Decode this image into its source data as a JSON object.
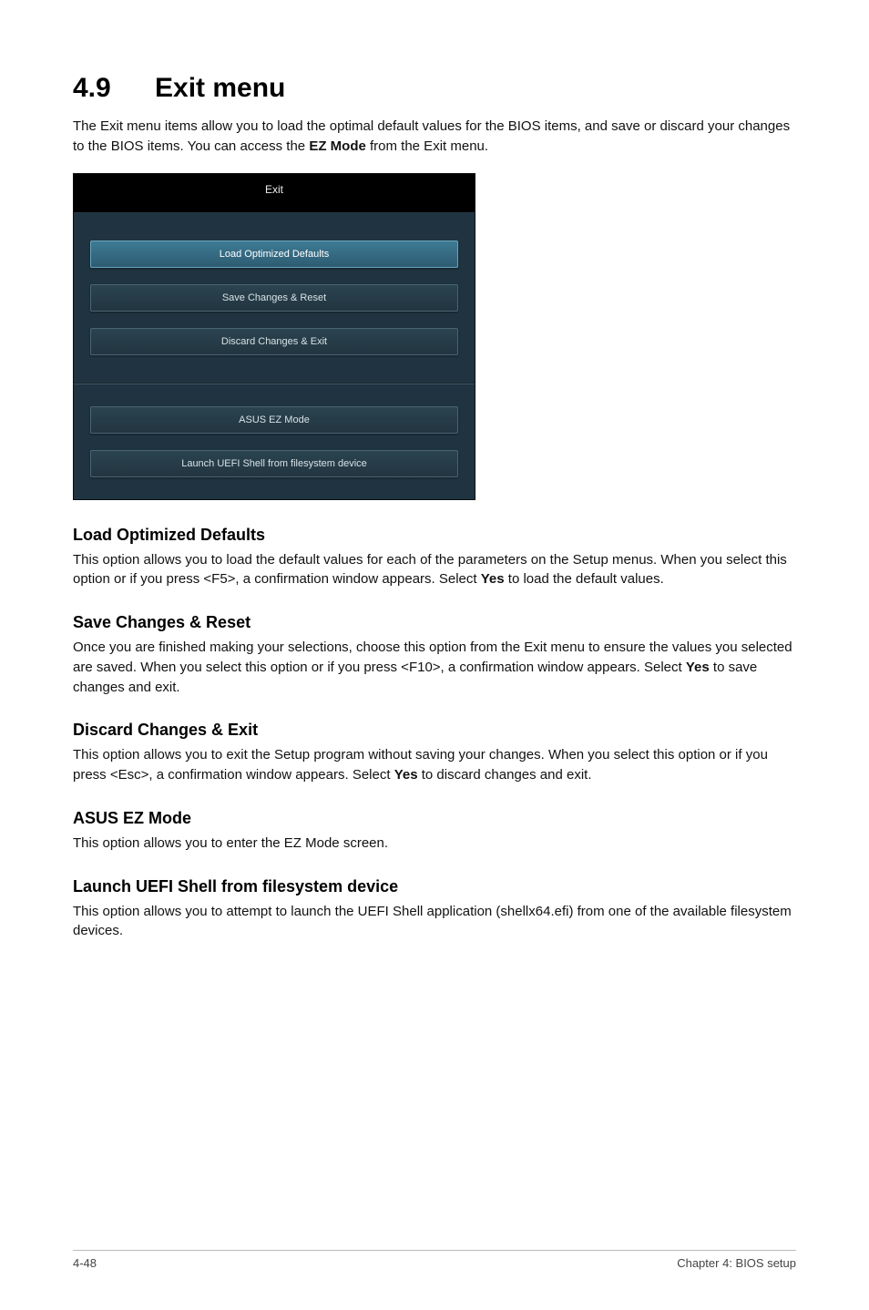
{
  "heading": {
    "number": "4.9",
    "title": "Exit menu"
  },
  "intro": {
    "part1": "The Exit menu items allow you to load the optimal default values for the BIOS items, and save or discard your changes to the BIOS items. You can access the ",
    "bold": "EZ Mode",
    "part2": " from the Exit menu."
  },
  "menu": {
    "header": "Exit",
    "items": [
      "Load Optimized Defaults",
      "Save Changes & Reset",
      "Discard Changes & Exit",
      "ASUS EZ Mode",
      "Launch UEFI Shell from filesystem device"
    ]
  },
  "sections": {
    "load": {
      "title": "Load Optimized Defaults",
      "p1": "This option allows you to load the default values for each of the parameters on the Setup menus. When you select this option or if you press <F5>, a confirmation window appears. Select ",
      "bold": "Yes",
      "p2": " to load the default values."
    },
    "save": {
      "title": "Save Changes & Reset",
      "p1": "Once you are finished making your selections, choose this option from the Exit menu to ensure the values you selected are saved. When you select this option or if you press <F10>, a confirmation window appears. Select ",
      "bold": "Yes",
      "p2": " to save changes and exit."
    },
    "discard": {
      "title": "Discard Changes & Exit",
      "p1": "This option allows you to exit the Setup program without saving your changes. When you select this option or if you press <Esc>, a confirmation window appears. Select ",
      "bold": "Yes",
      "p2": " to discard changes and exit."
    },
    "ez": {
      "title": "ASUS EZ Mode",
      "p": "This option allows you to enter the EZ Mode screen."
    },
    "uefi": {
      "title": "Launch UEFI Shell from filesystem device",
      "p": "This option allows you to attempt to launch the UEFI Shell application (shellx64.efi) from one of the available filesystem devices."
    }
  },
  "footer": {
    "left": "4-48",
    "right": "Chapter 4: BIOS setup"
  }
}
